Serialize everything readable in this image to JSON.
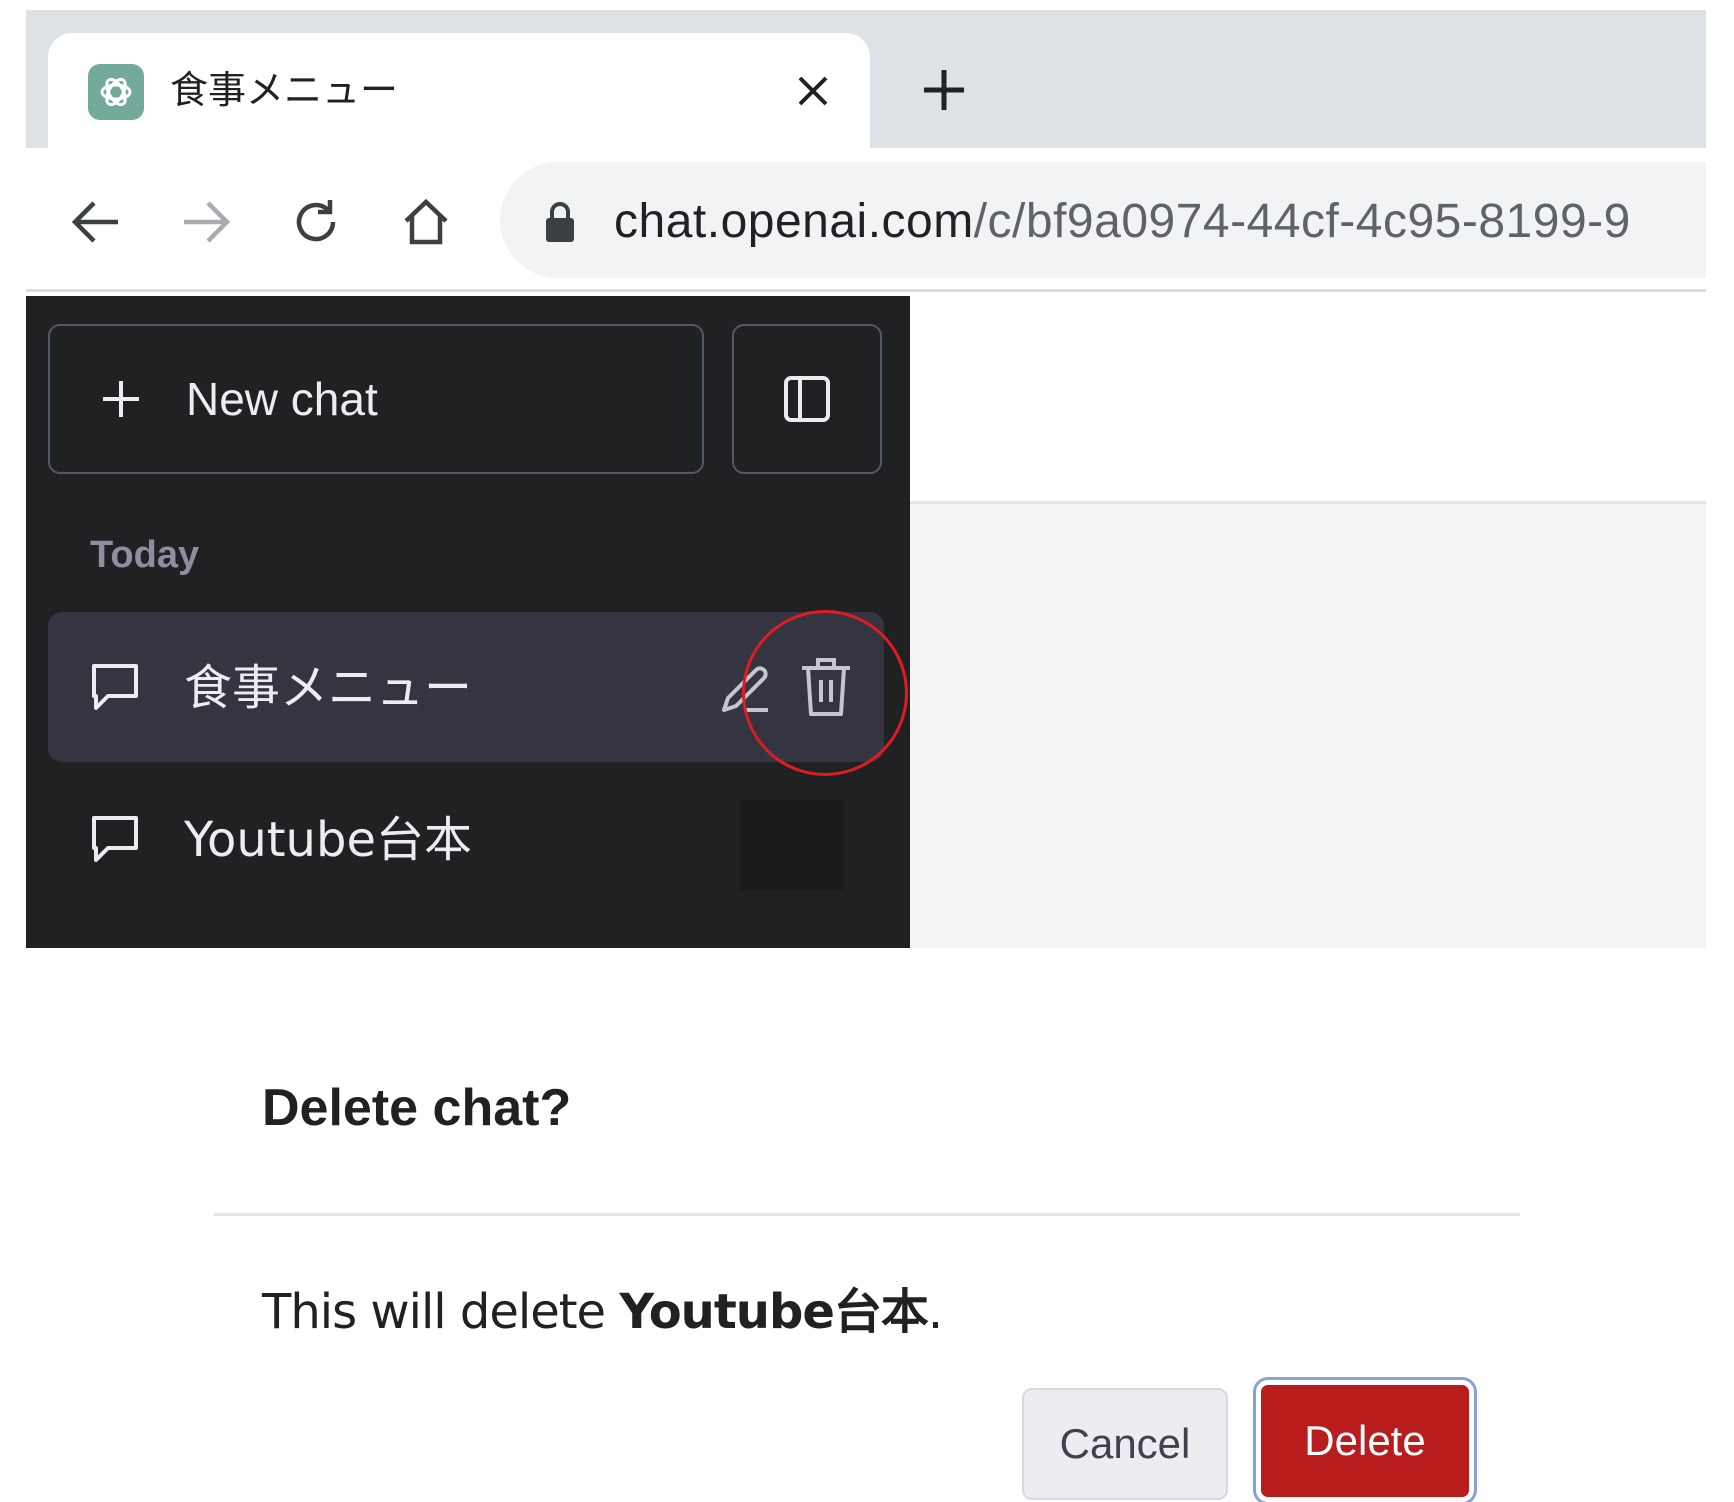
{
  "browser": {
    "tab": {
      "title": "食事メニュー",
      "favicon": "openai-logo-icon"
    },
    "address_bar": {
      "host": "chat.openai.com",
      "path": "/c/bf9a0974-44cf-4c95-8199-9"
    }
  },
  "sidebar": {
    "new_chat_label": "New chat",
    "section_label": "Today",
    "chats": [
      {
        "label": "食事メニュー",
        "selected": true
      },
      {
        "label": "Youtube台本",
        "selected": false
      }
    ]
  },
  "dialog": {
    "title": "Delete chat?",
    "body_prefix": "This will delete ",
    "body_target": "Youtube台本",
    "body_suffix": ".",
    "cancel_label": "Cancel",
    "delete_label": "Delete"
  },
  "colors": {
    "sidebar_bg": "#202123",
    "selected_item_bg": "#343541",
    "delete_red": "#b91c1c",
    "highlight_circle": "#e01b24"
  }
}
